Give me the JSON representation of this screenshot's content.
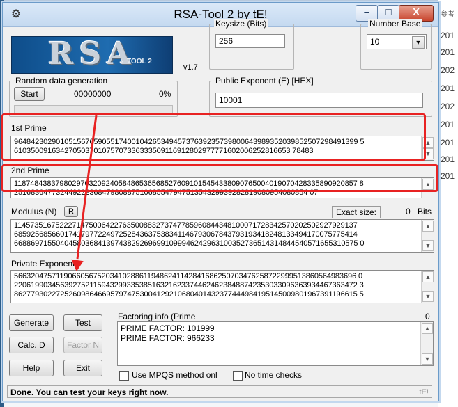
{
  "background": {
    "right_title": "参考",
    "years": [
      "201",
      "201",
      "202",
      "201",
      "202",
      "201",
      "201",
      "201",
      "201"
    ]
  },
  "window": {
    "title": "RSA-Tool 2 by tE!",
    "controls": {
      "minimize": "–",
      "maximize": "□",
      "close": "X"
    }
  },
  "logo": {
    "text": "RSA",
    "subtitle": "TOOL 2",
    "version": "v1.7"
  },
  "keysize": {
    "label": "Keysize (Bits)",
    "value": "256"
  },
  "number_base": {
    "label": "Number Base",
    "value": "10"
  },
  "random": {
    "label": "Random data generation",
    "start_label": "Start",
    "counter": "00000000",
    "percent": "0%"
  },
  "public_exponent": {
    "label": "Public Exponent (E) [HEX]",
    "value": "10001"
  },
  "first_prime": {
    "label": "1st Prime",
    "lines": [
      "9648423029010515676590551740010426534945737639235739800643989352039852507298491399 5",
      "610350091634270503701075707336333509116912802977771602006252816653 78483"
    ]
  },
  "second_prime": {
    "label": "2nd Prime",
    "lines": [
      "1187484383798029703209240584865365685276091015454338090765004019070428335890920857 8",
      "2516836477324492223684798088751068554794751354329939282819080954080854 07"
    ]
  },
  "modulus": {
    "label": "Modulus (N)",
    "r_label": "R",
    "exact_size_label": "Exact size:",
    "size_value": "0",
    "bits_label": "Bits",
    "lines": [
      "1145735167522271475006422763500883273747785960844348100071728342570202502927929137",
      "6859256856601741797722497252843637538341146793067843793193418248133494170075775414",
      "6688697155040458036841397438292696991099946242963100352736514314844540571655310575 0"
    ]
  },
  "private_exponent": {
    "label": "Private Exponent",
    "lines": [
      "5663204757119066056752034102886119486241142841686250703476258722999513860564983696 0",
      "2206199034563927521159432993353851632162337446246238488742353033096363934467363472 3",
      "8627793022725260986466957974753004129210680401432377444984195145009801967391196615 5"
    ]
  },
  "buttons": {
    "generate": "Generate",
    "test": "Test",
    "calc_d": "Calc. D",
    "factor_n": "Factor N",
    "help": "Help",
    "exit": "Exit"
  },
  "factoring": {
    "label": "Factoring info (Prime",
    "count": "0",
    "lines": [
      "PRIME FACTOR: 101999",
      "PRIME FACTOR: 966233"
    ]
  },
  "options": {
    "mpqs_label": "Use MPQS method onl",
    "no_time_label": "No time checks"
  },
  "status": {
    "text": "Done. You can test your keys right now.",
    "corner": "tE!"
  },
  "annotation_color": "#e82222"
}
